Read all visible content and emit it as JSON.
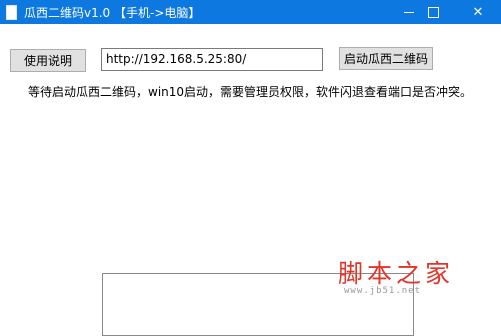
{
  "window": {
    "title": "瓜西二维码v1.0 【手机->电脑】",
    "title_bar_color": "#0c78e0",
    "controls": {
      "minimize_icon": "minimize-icon",
      "maximize_icon": "maximize-icon",
      "close_symbol": "✕"
    }
  },
  "toolbar": {
    "help_button_label": "使用说明",
    "url_value": "http://192.168.5.25:80/",
    "start_button_label": "启动瓜西二维码"
  },
  "status": {
    "message": "等待启动瓜西二维码，win10启动，需要管理员权限，软件闪退查看端口是否冲突。"
  },
  "watermark": {
    "main": "脚本之家",
    "sub": "www.jb51.net"
  }
}
